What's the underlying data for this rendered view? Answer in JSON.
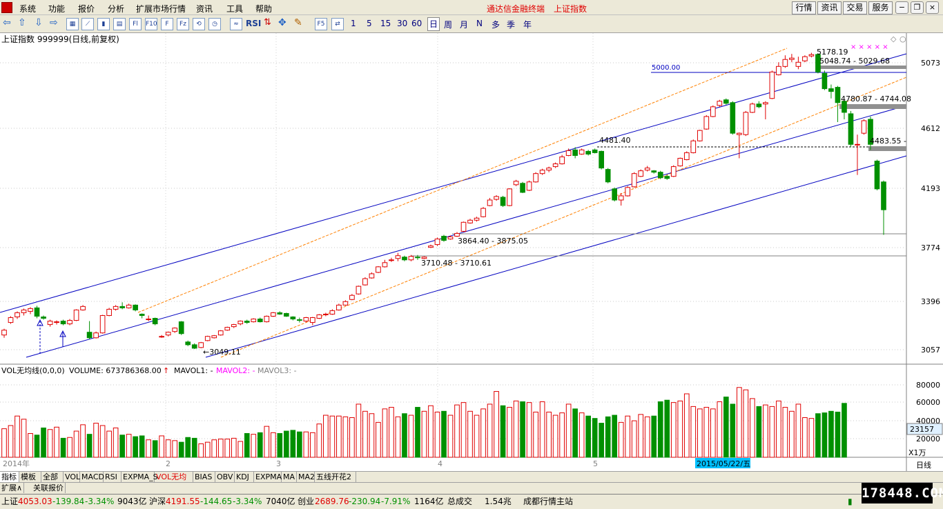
{
  "menu": {
    "items": [
      "系统",
      "功能",
      "报价",
      "分析",
      "扩展市场行情",
      "资讯",
      "工具",
      "帮助"
    ],
    "brand": "通达信金融终端",
    "index_name": "上证指数",
    "right_buttons": [
      "行情",
      "资讯",
      "交易",
      "服务"
    ]
  },
  "toolbar": {
    "icon_buttons": [
      {
        "label": "Fl",
        "name": "f10-icon"
      },
      {
        "label": "F10",
        "name": "fundamentals-icon"
      },
      {
        "label": "F",
        "name": "finance-icon"
      },
      {
        "label": "Fz",
        "name": "fz-icon"
      },
      {
        "label": "⟲",
        "name": "refresh-icon"
      },
      {
        "label": "RSI",
        "name": "rsi-icon"
      },
      {
        "label": "✥",
        "name": "move-icon"
      },
      {
        "label": "✎",
        "name": "pen-icon"
      }
    ],
    "minute_periods": [
      "F5",
      "1",
      "5",
      "15",
      "30",
      "60"
    ],
    "periods": [
      "日",
      "周",
      "月",
      "N",
      "多",
      "季",
      "年"
    ],
    "active_period": "日"
  },
  "chart": {
    "header": "上证指数 999999(日线,前复权)",
    "y_ticks": [
      "5073",
      "4612",
      "4193",
      "3774",
      "3396",
      "3057"
    ],
    "annotations": {
      "high": "5178.19",
      "gap1": "5048.74 - 5029.68",
      "line5000": "5000.00",
      "gap2": "4780.87 - 4744.08",
      "level4481": "4481.40",
      "gap3": "4483.55 -",
      "gap4": "3864.40 - 3875.05",
      "gap5": "3710.48 - 3710.61",
      "low": "3049.11"
    },
    "vol_header": {
      "prefix": "VOL无均线(0,0,0)",
      "volume": "VOLUME: 673786368.00",
      "mavol1": "MAVOL1: -",
      "mavol2": "MAVOL2: -",
      "mavol3": "MAVOL3: -"
    },
    "vol_ticks": [
      "80000",
      "60000",
      "40000",
      "20000"
    ],
    "vol_current": "23157",
    "vol_unit": "X1万",
    "x_labels": [
      "2014年",
      "2",
      "3",
      "4",
      "5"
    ],
    "cursor_date": "2015/05/22/五",
    "right_period": "日线"
  },
  "chart_data": {
    "type": "candlestick",
    "title": "上证指数 999999(日线,前复权)",
    "ylim": [
      2990,
      5260
    ],
    "candles": [
      [
        3150,
        3185,
        3130,
        3195
      ],
      [
        3240,
        3275,
        3230,
        3285
      ],
      [
        3280,
        3310,
        3265,
        3320
      ],
      [
        3310,
        3330,
        3290,
        3340
      ],
      [
        3320,
        3340,
        3300,
        3350
      ],
      [
        3345,
        3285,
        3270,
        3360
      ],
      [
        3280,
        3270,
        3260,
        3290
      ],
      [
        3225,
        3250,
        3210,
        3260
      ],
      [
        3240,
        3245,
        3225,
        3255
      ],
      [
        3250,
        3230,
        3220,
        3260
      ],
      [
        3230,
        3255,
        3220,
        3265
      ],
      [
        3255,
        3330,
        3250,
        3335
      ],
      [
        3330,
        3355,
        3325,
        3365
      ],
      [
        3170,
        3130,
        3120,
        3250
      ],
      [
        3130,
        3165,
        3125,
        3175
      ],
      [
        3165,
        3290,
        3160,
        3295
      ],
      [
        3290,
        3335,
        3285,
        3345
      ],
      [
        3335,
        3355,
        3325,
        3365
      ],
      [
        3355,
        3345,
        3335,
        3385
      ],
      [
        3345,
        3365,
        3340,
        3375
      ],
      [
        3365,
        3330,
        3320,
        3370
      ],
      [
        3300,
        3290,
        3270,
        3305
      ],
      [
        3260,
        3265,
        3250,
        3290
      ],
      [
        3270,
        3230,
        3220,
        3275
      ],
      [
        3140,
        3140,
        3130,
        3150
      ],
      [
        3150,
        3170,
        3140,
        3175
      ],
      [
        3175,
        3200,
        3165,
        3205
      ],
      [
        3245,
        3160,
        3150,
        3250
      ],
      [
        3100,
        3080,
        3070,
        3110
      ],
      [
        3080,
        3055,
        3049,
        3090
      ],
      [
        3060,
        3095,
        3055,
        3100
      ],
      [
        3110,
        3140,
        3105,
        3145
      ],
      [
        3130,
        3145,
        3125,
        3150
      ],
      [
        3150,
        3180,
        3145,
        3185
      ],
      [
        3185,
        3205,
        3180,
        3210
      ],
      [
        3210,
        3225,
        3200,
        3230
      ],
      [
        3230,
        3250,
        3220,
        3255
      ],
      [
        3250,
        3240,
        3230,
        3260
      ],
      [
        3245,
        3265,
        3240,
        3270
      ],
      [
        3265,
        3245,
        3240,
        3275
      ],
      [
        3245,
        3285,
        3240,
        3290
      ],
      [
        3285,
        3310,
        3280,
        3315
      ],
      [
        3310,
        3300,
        3295,
        3320
      ],
      [
        3305,
        3285,
        3280,
        3310
      ],
      [
        3280,
        3265,
        3255,
        3285
      ],
      [
        3260,
        3255,
        3240,
        3275
      ],
      [
        3250,
        3275,
        3240,
        3280
      ],
      [
        3240,
        3275,
        3220,
        3280
      ],
      [
        3270,
        3295,
        3265,
        3300
      ],
      [
        3295,
        3300,
        3285,
        3310
      ],
      [
        3300,
        3325,
        3295,
        3335
      ],
      [
        3330,
        3365,
        3325,
        3375
      ],
      [
        3365,
        3390,
        3360,
        3400
      ],
      [
        3405,
        3435,
        3400,
        3445
      ],
      [
        3445,
        3500,
        3440,
        3505
      ],
      [
        3510,
        3555,
        3505,
        3565
      ],
      [
        3560,
        3590,
        3555,
        3600
      ],
      [
        3600,
        3640,
        3595,
        3645
      ],
      [
        3640,
        3670,
        3635,
        3690
      ],
      [
        3690,
        3690,
        3675,
        3705
      ],
      [
        3700,
        3720,
        3680,
        3740
      ],
      [
        3710,
        3690,
        3680,
        3720
      ],
      [
        3690,
        3715,
        3680,
        3725
      ],
      [
        3710,
        3705,
        3690,
        3725
      ],
      [
        3700,
        3710,
        3695,
        3715
      ],
      [
        3780,
        3790,
        3775,
        3800
      ],
      [
        3800,
        3840,
        3790,
        3850
      ],
      [
        3860,
        3830,
        3820,
        3870
      ],
      [
        3840,
        3855,
        3835,
        3865
      ],
      [
        3860,
        3880,
        3855,
        3890
      ],
      [
        3895,
        3960,
        3890,
        3965
      ],
      [
        3955,
        3975,
        3950,
        3985
      ],
      [
        3975,
        3990,
        3965,
        4000
      ],
      [
        4000,
        4060,
        3995,
        4070
      ],
      [
        4080,
        4120,
        4075,
        4135
      ],
      [
        4125,
        4145,
        4115,
        4155
      ],
      [
        4140,
        4080,
        4070,
        4150
      ],
      [
        4080,
        4200,
        4075,
        4205
      ],
      [
        4230,
        4255,
        4220,
        4265
      ],
      [
        4240,
        4175,
        4170,
        4250
      ],
      [
        4190,
        4250,
        4185,
        4260
      ],
      [
        4250,
        4310,
        4245,
        4320
      ],
      [
        4310,
        4335,
        4300,
        4345
      ],
      [
        4335,
        4350,
        4320,
        4360
      ],
      [
        4360,
        4380,
        4350,
        4390
      ],
      [
        4380,
        4430,
        4375,
        4445
      ],
      [
        4440,
        4475,
        4435,
        4490
      ],
      [
        4480,
        4440,
        4420,
        4500
      ],
      [
        4450,
        4480,
        4445,
        4490
      ],
      [
        4470,
        4450,
        4440,
        4480
      ],
      [
        4480,
        4460,
        4455,
        4490
      ],
      [
        4470,
        4350,
        4340,
        4475
      ],
      [
        4340,
        4250,
        4240,
        4350
      ],
      [
        4200,
        4120,
        4110,
        4210
      ],
      [
        4120,
        4150,
        4080,
        4170
      ],
      [
        4150,
        4210,
        4145,
        4220
      ],
      [
        4215,
        4310,
        4210,
        4320
      ],
      [
        4290,
        4330,
        4285,
        4340
      ],
      [
        4335,
        4350,
        4325,
        4365
      ],
      [
        4330,
        4320,
        4310,
        4335
      ],
      [
        4320,
        4280,
        4270,
        4330
      ],
      [
        4290,
        4275,
        4265,
        4300
      ],
      [
        4290,
        4360,
        4285,
        4370
      ],
      [
        4365,
        4420,
        4360,
        4425
      ],
      [
        4410,
        4460,
        4405,
        4470
      ],
      [
        4460,
        4545,
        4455,
        4555
      ],
      [
        4545,
        4620,
        4540,
        4625
      ],
      [
        4630,
        4720,
        4625,
        4730
      ],
      [
        4720,
        4790,
        4715,
        4800
      ],
      [
        4800,
        4830,
        4790,
        4840
      ],
      [
        4840,
        4815,
        4805,
        4850
      ],
      [
        4820,
        4600,
        4590,
        4830
      ],
      [
        4590,
        4600,
        4420,
        4605
      ],
      [
        4590,
        4750,
        4580,
        4760
      ],
      [
        4750,
        4810,
        4745,
        4820
      ],
      [
        4810,
        4790,
        4780,
        4830
      ],
      [
        4810,
        4820,
        4700,
        4830
      ],
      [
        4850,
        5040,
        4845,
        5050
      ],
      [
        5020,
        5080,
        5015,
        5110
      ],
      [
        5080,
        5130,
        5070,
        5160
      ],
      [
        5130,
        5140,
        5110,
        5170
      ],
      [
        5080,
        5110,
        5060,
        5150
      ],
      [
        5120,
        5150,
        5110,
        5160
      ],
      [
        5155,
        5165,
        5145,
        5178
      ],
      [
        5166,
        5040,
        5030,
        5175
      ],
      [
        5030,
        4920,
        4910,
        5050
      ],
      [
        4920,
        4900,
        4850,
        4950
      ],
      [
        4930,
        4820,
        4680,
        4940
      ],
      [
        4830,
        4750,
        4700,
        4840
      ],
      [
        4740,
        4520,
        4500,
        4760
      ],
      [
        4520,
        4520,
        4300,
        4590
      ],
      [
        4600,
        4690,
        4590,
        4700
      ],
      [
        4700,
        4520,
        4480,
        4720
      ],
      [
        4400,
        4200,
        4190,
        4410
      ],
      [
        4250,
        4050,
        3870,
        4260
      ]
    ],
    "volume_ylim": [
      0,
      100000
    ],
    "volumes": [
      36000,
      40000,
      52000,
      48000,
      30000,
      28000,
      37000,
      35000,
      38000,
      24000,
      25000,
      33000,
      41000,
      29000,
      43000,
      40000,
      33000,
      37000,
      28000,
      29000,
      26000,
      27000,
      22000,
      21000,
      27000,
      22000,
      21000,
      19000,
      25000,
      24000,
      17000,
      19000,
      22000,
      23000,
      23000,
      24000,
      20000,
      30000,
      29000,
      31000,
      39000,
      31000,
      30000,
      33000,
      34000,
      32000,
      32000,
      31000,
      42000,
      53000,
      52000,
      52000,
      51000,
      50000,
      67000,
      58000,
      55000,
      44000,
      61000,
      63000,
      51000,
      55000,
      53000,
      63000,
      58000,
      65000,
      57000,
      58000,
      53000,
      66000,
      69000,
      58000,
      53000,
      61000,
      67000,
      83000,
      65000,
      63000,
      71000,
      70000,
      69000,
      57000,
      70000,
      57000,
      53000,
      56000,
      67000,
      61000,
      56000,
      52000,
      49000,
      43000,
      51000,
      53000,
      44000,
      52000,
      46000,
      54000,
      51000,
      52000,
      70000,
      72000,
      69000,
      71000,
      80000,
      64000,
      61000,
      63000,
      61000,
      70000,
      76000,
      67000,
      88000,
      85000,
      74000,
      64000,
      66000,
      64000,
      71000,
      63000,
      58000,
      67000,
      50000,
      49000,
      55000,
      56000,
      58000,
      57000,
      68000
    ]
  },
  "tabs": {
    "items": [
      "指标",
      "模板",
      "全部",
      "VOL",
      "MACD",
      "RSI",
      "EXPMA_S",
      "VOL无均线",
      "BIAS",
      "OBV",
      "KDJ",
      "EXPMA",
      "MA",
      "MA2",
      "五线开花2"
    ],
    "active": "指标",
    "red": "VOL无均线",
    "row2": [
      "扩展∧",
      "关联报价"
    ]
  },
  "status": {
    "sh_label": "上证",
    "sh_value": "4053.03",
    "sh_change": "-139.84",
    "sh_pct": "-3.34%",
    "sh_amount": "9043亿",
    "hs_label": "沪深",
    "hs_value": "4191.55",
    "hs_change": "-144.65",
    "hs_pct": "-3.34%",
    "hs_amount": "7040亿",
    "cy_label": "创业",
    "cy_value": "2689.76",
    "cy_change": "-230.94",
    "cy_pct": "-7.91%",
    "cy_amount": "1164亿",
    "total_label": "总成交",
    "total_value": "1.54兆",
    "server": "成都行情主站"
  },
  "watermark": "178448.COM",
  "colors": {
    "up": "#e00000",
    "down": "#009000",
    "channel": "#0000c0",
    "fib": "#ff8000"
  }
}
